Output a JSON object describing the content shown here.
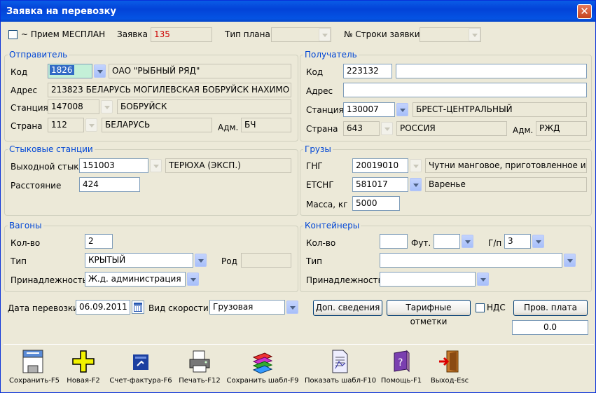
{
  "window": {
    "title": "Заявка на перевозку",
    "close": "✕"
  },
  "top": {
    "priem_label": "~ Прием МЕСПЛАН",
    "zayavka_label": "Заявка",
    "zayavka_value": "135",
    "tip_plana_label": "Тип плана",
    "stroka_label": "№ Строки заявки"
  },
  "sender": {
    "title": "Отправитель",
    "kod_label": "Код",
    "kod_value": "1826",
    "kod_name": "ОАО \"РЫБНЫЙ  РЯД\"",
    "adres_label": "Адрес",
    "adres_value": "213823 БЕЛАРУСЬ МОГИЛЕВСКАЯ БОБРУЙСК НАХИМО",
    "stanciya_label": "Станция",
    "stanciya_code": "147008",
    "stanciya_name": "БОБРУЙСК",
    "strana_label": "Страна",
    "strana_code": "112",
    "strana_name": "БЕЛАРУСЬ",
    "adm_label": "Адм.",
    "adm_value": "БЧ"
  },
  "receiver": {
    "title": "Получатель",
    "kod_label": "Код",
    "kod_value": "223132",
    "kod_name": "",
    "adres_label": "Адрес",
    "adres_value": "",
    "stanciya_label": "Станция",
    "stanciya_code": "130007",
    "stanciya_name": "БРЕСТ-ЦЕНТРАЛЬНЫЙ",
    "strana_label": "Страна",
    "strana_code": "643",
    "strana_name": "РОССИЯ",
    "adm_label": "Адм.",
    "adm_value": "РЖД"
  },
  "junction": {
    "title": "Стыковые станции",
    "exit_label": "Выходной стык",
    "exit_code": "151003",
    "exit_name": "ТЕРЮХА (ЭКСП.)",
    "dist_label": "Расстояние",
    "dist_value": "424"
  },
  "cargo": {
    "title": "Грузы",
    "gng_label": "ГНГ",
    "gng_code": "20019010",
    "gng_name": "Чутни манговое, приготовленное или",
    "etsng_label": "ЕТСНГ",
    "etsng_code": "581017",
    "etsng_name": "Варенье",
    "mass_label": "Масса, кг",
    "mass_value": "5000"
  },
  "wagons": {
    "title": "Вагоны",
    "count_label": "Кол-во",
    "count_value": "2",
    "type_label": "Тип",
    "type_value": "КРЫТЫЙ",
    "rod_label": "Род",
    "rod_value": "",
    "owner_label": "Принадлежность",
    "owner_value": "Ж.д. администрация"
  },
  "containers": {
    "title": "Контейнеры",
    "count_label": "Кол-во",
    "count_value": "",
    "fut_label": "Фут.",
    "fut_value": "",
    "gp_label": "Г/п",
    "gp_value": "3",
    "type_label": "Тип",
    "type_value": "",
    "owner_label": "Принадлежность",
    "owner_value": ""
  },
  "bottom": {
    "date_label": "Дата перевозки",
    "date_value": "06.09.2011",
    "speed_label": "Вид скорости",
    "speed_value": "Грузовая",
    "dop_btn": "Доп. сведения",
    "tarif_btn": "Тарифные отметки",
    "nds_label": "НДС",
    "prov_btn": "Пров. плата",
    "pay_value": "0.0"
  },
  "toolbar": [
    {
      "label": "Сохранить-F5",
      "icon": "floppy-disk-icon"
    },
    {
      "label": "Новая-F2",
      "icon": "plus-icon"
    },
    {
      "label": "Счет-фактура-F6",
      "icon": "invoice-icon"
    },
    {
      "label": "Печать-F12",
      "icon": "printer-icon"
    },
    {
      "label": "Сохранить шабл-F9",
      "icon": "books-icon"
    },
    {
      "label": "Показать шабл-F10",
      "icon": "document-icon"
    },
    {
      "label": "Помощь-F1",
      "icon": "help-book-icon"
    },
    {
      "label": "Выход-Esc",
      "icon": "exit-door-icon"
    }
  ],
  "colors": {
    "group_title": "#0046d5",
    "zayavka_value": "#cc0000",
    "selected": "#316ac5",
    "title_bar": "#0553e3"
  }
}
